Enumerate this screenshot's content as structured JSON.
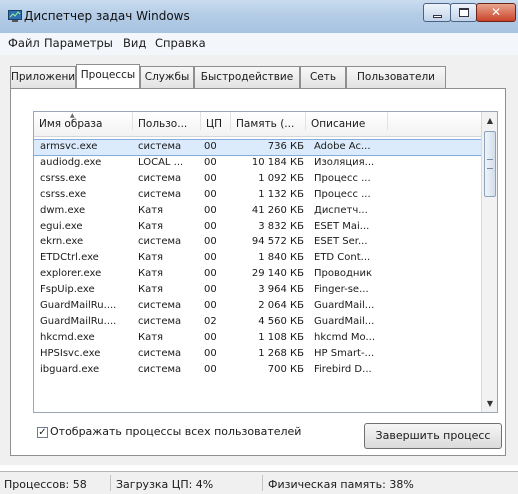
{
  "window": {
    "title": "Диспетчер задач Windows"
  },
  "menu": [
    "Файл",
    "Параметры",
    "Вид",
    "Справка"
  ],
  "tabs": [
    {
      "label": "Приложения",
      "active": false
    },
    {
      "label": "Процессы",
      "active": true
    },
    {
      "label": "Службы",
      "active": false
    },
    {
      "label": "Быстродействие",
      "active": false
    },
    {
      "label": "Сеть",
      "active": false
    },
    {
      "label": "Пользователи",
      "active": false
    }
  ],
  "table": {
    "columns": [
      "Имя образа",
      "Пользо...",
      "ЦП",
      "Память (...",
      "Описание"
    ],
    "rows": [
      [
        "armsvc.exe",
        "система",
        "00",
        "736 КБ",
        "Adobe Ac..."
      ],
      [
        "audiodg.exe",
        "LOCAL ...",
        "00",
        "10 184 КБ",
        "Изоляция..."
      ],
      [
        "csrss.exe",
        "система",
        "00",
        "1 092 КБ",
        "Процесс ..."
      ],
      [
        "csrss.exe",
        "система",
        "00",
        "1 132 КБ",
        "Процесс ..."
      ],
      [
        "dwm.exe",
        "Катя",
        "00",
        "41 260 КБ",
        "Диспетч..."
      ],
      [
        "egui.exe",
        "Катя",
        "00",
        "3 832 КБ",
        "ESET Mai..."
      ],
      [
        "ekrn.exe",
        "система",
        "00",
        "94 572 КБ",
        "ESET Ser..."
      ],
      [
        "ETDCtrl.exe",
        "Катя",
        "00",
        "1 840 КБ",
        "ETD Cont..."
      ],
      [
        "explorer.exe",
        "Катя",
        "00",
        "29 140 КБ",
        "Проводник"
      ],
      [
        "FspUip.exe",
        "Катя",
        "00",
        "3 964 КБ",
        "Finger-se..."
      ],
      [
        "GuardMailRu....",
        "система",
        "00",
        "2 064 КБ",
        "GuardMail..."
      ],
      [
        "GuardMailRu....",
        "система",
        "02",
        "4 560 КБ",
        "GuardMail..."
      ],
      [
        "hkcmd.exe",
        "Катя",
        "00",
        "1 108 КБ",
        "hkcmd Mo..."
      ],
      [
        "HPSIsvc.exe",
        "система",
        "00",
        "1 268 КБ",
        "HP Smart-..."
      ],
      [
        "ibguard.exe",
        "система",
        "00",
        "700 КБ",
        "Firebird D..."
      ]
    ]
  },
  "show_all_users": {
    "label": "Отображать процессы всех пользователей",
    "checked": true
  },
  "end_process_button": "Завершить процесс",
  "status": {
    "processes": "Процессов: 58",
    "cpu": "Загрузка ЦП: 4%",
    "memory": "Физическая память: 38%"
  }
}
